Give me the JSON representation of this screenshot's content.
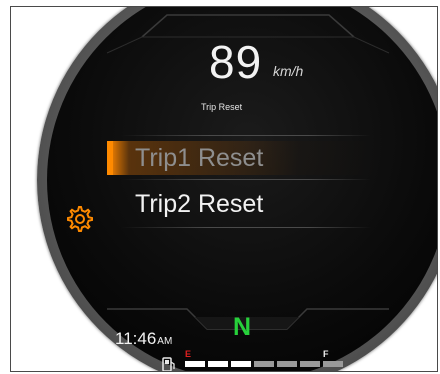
{
  "speed": {
    "value": "89",
    "unit": "km/h"
  },
  "screen": {
    "title": "Trip Reset"
  },
  "menu": {
    "items": [
      {
        "label": "Trip1 Reset",
        "selected": true
      },
      {
        "label": "Trip2 Reset",
        "selected": false
      }
    ]
  },
  "settings_icon": "gear-icon",
  "clock": {
    "time": "11:46",
    "ampm": "AM"
  },
  "gear": "N",
  "fuel": {
    "empty_label": "E",
    "full_label": "F",
    "level": 0.4,
    "segments": 7,
    "filled_segments": 3
  },
  "colors": {
    "accent": "#ff8a00",
    "gear_neutral": "#27d13b",
    "fuel_empty": "#e02020",
    "text": "#f2f2f2"
  }
}
